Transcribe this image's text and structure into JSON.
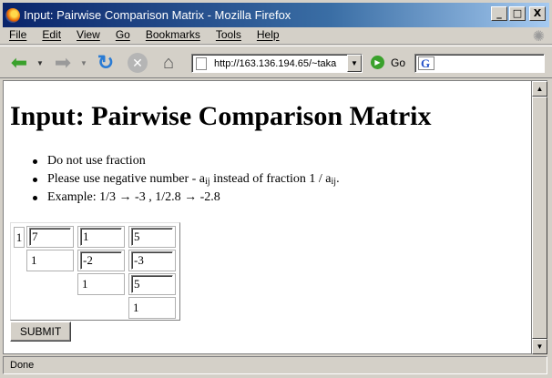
{
  "window": {
    "title": "Input: Pairwise Comparison Matrix - Mozilla Firefox",
    "buttons": {
      "minimize": "_",
      "maximize": "□",
      "close": "X"
    }
  },
  "menubar": {
    "items": [
      "File",
      "Edit",
      "View",
      "Go",
      "Bookmarks",
      "Tools",
      "Help"
    ]
  },
  "toolbar": {
    "url": "http://163.136.194.65/~taka",
    "go_label": "Go",
    "icons": [
      "back-arrow-icon",
      "forward-arrow-icon",
      "reload-icon",
      "stop-icon",
      "home-icon",
      "page-icon",
      "go-icon",
      "google-icon"
    ]
  },
  "page": {
    "title": "Input: Pairwise Comparison Matrix",
    "bullets": {
      "b1": "Do not use fraction",
      "b2_pre": "Please use negative number - a",
      "b2_sub1": "ij",
      "b2_mid": " instead of fraction 1 / a",
      "b2_sub2": "ij",
      "b2_post": ".",
      "b3": "Example: 1/3 → -3 , 1/2.8 → -2.8"
    },
    "matrix": {
      "row_label": "1",
      "r1": [
        "7",
        "1",
        "5"
      ],
      "r2_diag": "1",
      "r2": [
        "-2",
        "-3"
      ],
      "r3_diag": "1",
      "r3": [
        "5"
      ],
      "r4_diag": "1"
    },
    "submit_label": "SUBMIT"
  },
  "status": {
    "text": "Done"
  }
}
